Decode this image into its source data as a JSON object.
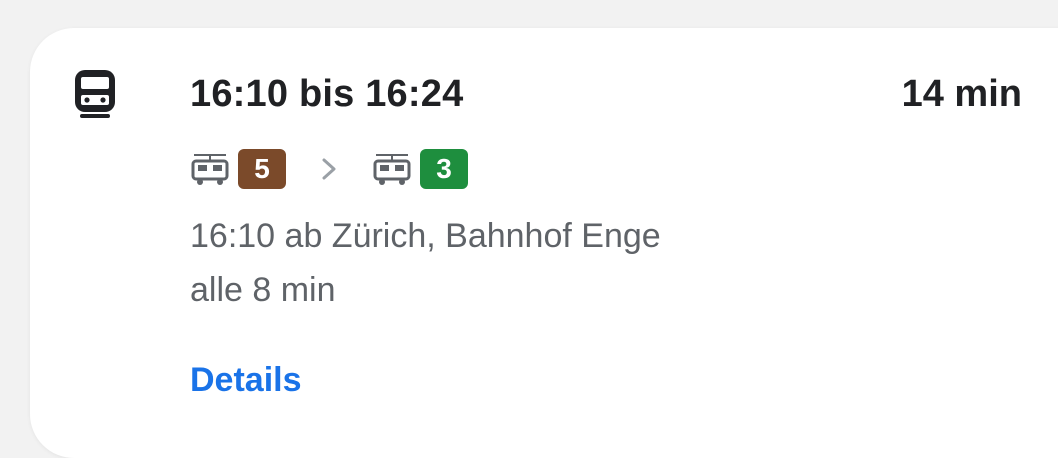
{
  "route": {
    "mode_icon": "train-icon",
    "time_range": "16:10 bis 16:24",
    "duration": "14 min",
    "legs": [
      {
        "vehicle_icon": "tram-icon",
        "line": "5",
        "color": "#7b4a2a"
      },
      {
        "vehicle_icon": "tram-icon",
        "line": "3",
        "color": "#1e8e3e"
      }
    ],
    "separator_icon": "chevron-right-icon",
    "departure": "16:10 ab Zürich, Bahnhof Enge",
    "frequency": "alle 8 min",
    "details_label": "Details"
  },
  "colors": {
    "primary_text": "#202124",
    "secondary_text": "#5f6368",
    "link": "#1a73e8",
    "background": "#f2f2f2",
    "card": "#ffffff"
  }
}
